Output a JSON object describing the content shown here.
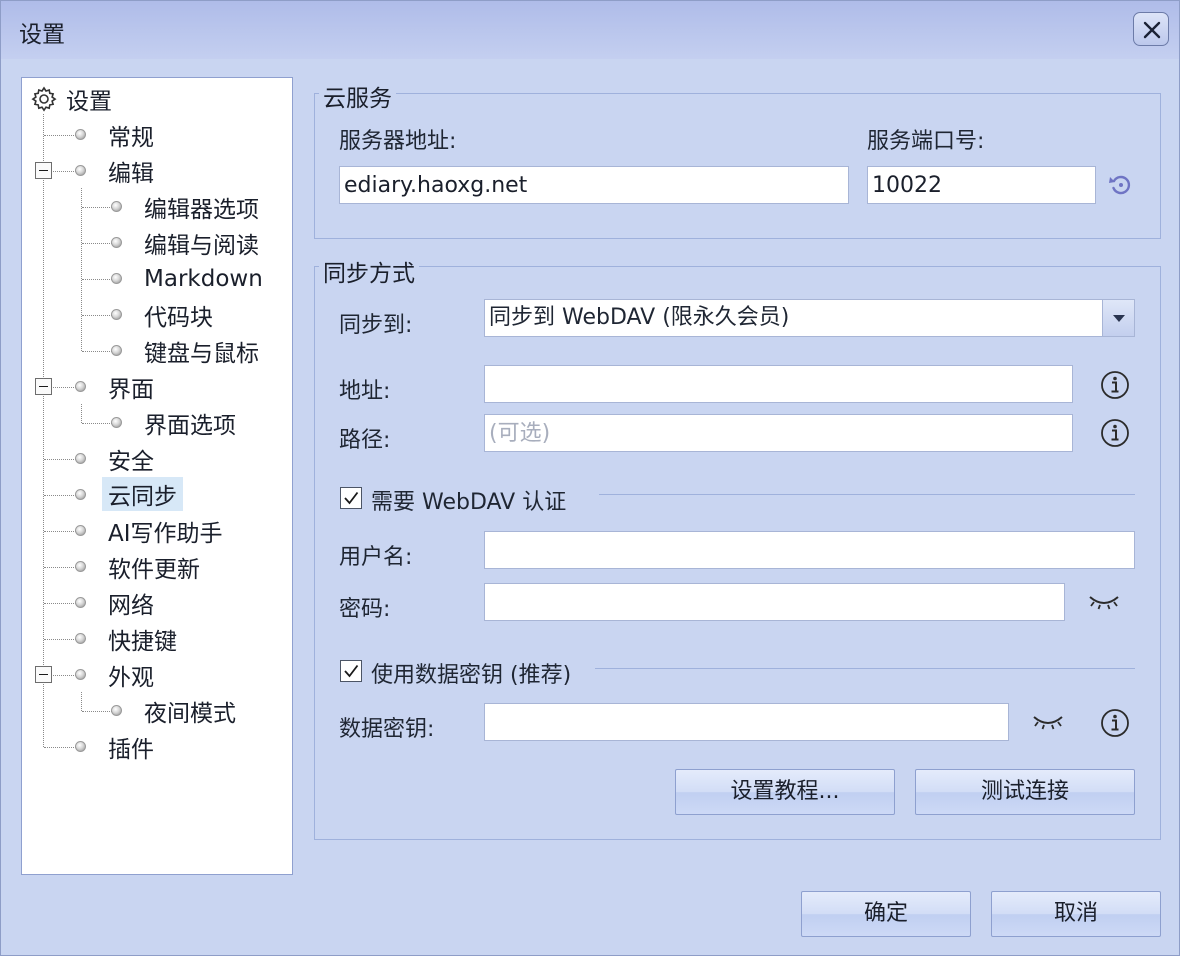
{
  "window": {
    "title": "设置"
  },
  "tree": {
    "root": "设置",
    "items": [
      {
        "label": "常规"
      },
      {
        "label": "编辑",
        "children": [
          "编辑器选项",
          "编辑与阅读",
          "Markdown",
          "代码块",
          "键盘与鼠标"
        ]
      },
      {
        "label": "界面",
        "children": [
          "界面选项"
        ]
      },
      {
        "label": "安全"
      },
      {
        "label": "云同步",
        "selected": true
      },
      {
        "label": "AI写作助手"
      },
      {
        "label": "软件更新"
      },
      {
        "label": "网络"
      },
      {
        "label": "快捷键"
      },
      {
        "label": "外观",
        "children": [
          "夜间模式"
        ]
      },
      {
        "label": "插件"
      }
    ]
  },
  "cloud_service": {
    "title": "云服务",
    "server_label": "服务器地址:",
    "server_value": "ediary.haoxg.net",
    "port_label": "服务端口号:",
    "port_value": "10022"
  },
  "sync": {
    "title": "同步方式",
    "sync_to_label": "同步到:",
    "sync_to_value": "同步到 WebDAV (限永久会员)",
    "address_label": "地址:",
    "address_value": "",
    "path_label": "路径:",
    "path_placeholder": "(可选)",
    "auth_checkbox": "需要 WebDAV 认证",
    "username_label": "用户名:",
    "username_value": "",
    "password_label": "密码:",
    "password_value": "",
    "key_checkbox": "使用数据密钥 (推荐)",
    "data_key_label": "数据密钥:",
    "data_key_value": "",
    "tutorial_button": "设置教程...",
    "test_button": "测试连接"
  },
  "footer": {
    "ok": "确定",
    "cancel": "取消"
  },
  "colors": {
    "window_bg": "#c9d5f1",
    "titlebar": "#b4c0eb",
    "selection": "#d7e8f7",
    "icon": "#6f74c4"
  }
}
